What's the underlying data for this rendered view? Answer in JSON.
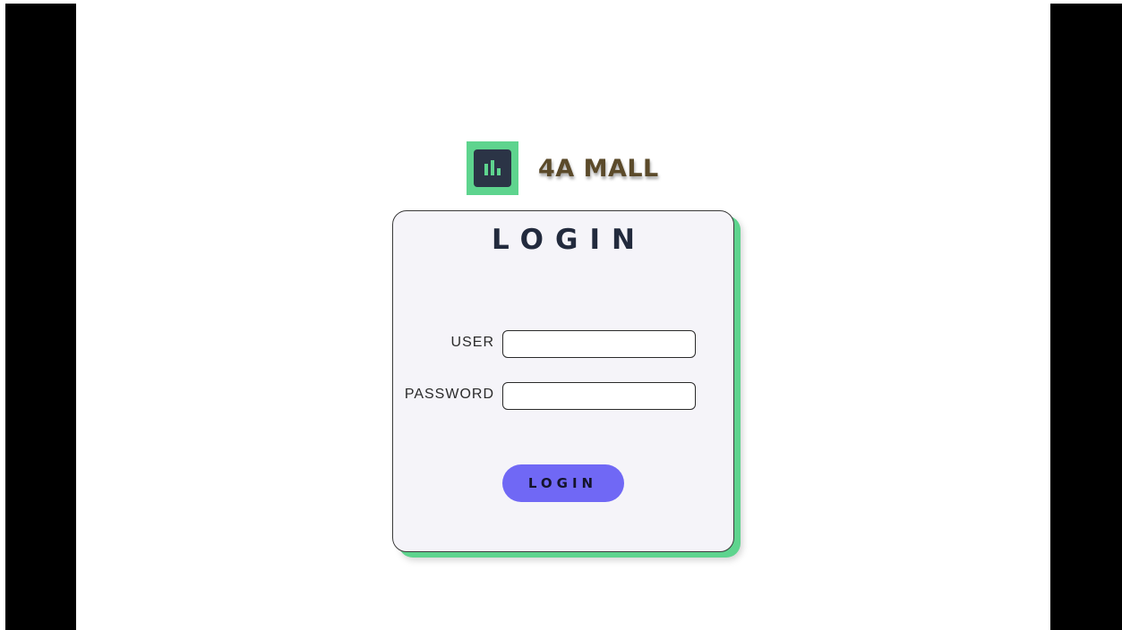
{
  "brand": {
    "name": "4A MALL",
    "logo_icon": "bar-chart-icon",
    "accent_color": "#5ed48e"
  },
  "login_card": {
    "title": "LOGIN",
    "fields": {
      "user": {
        "label": "USER",
        "value": "",
        "placeholder": ""
      },
      "password": {
        "label": "PASSWORD",
        "value": "",
        "placeholder": ""
      }
    },
    "submit_label": "LOGIN",
    "button_color": "#7068f5"
  }
}
